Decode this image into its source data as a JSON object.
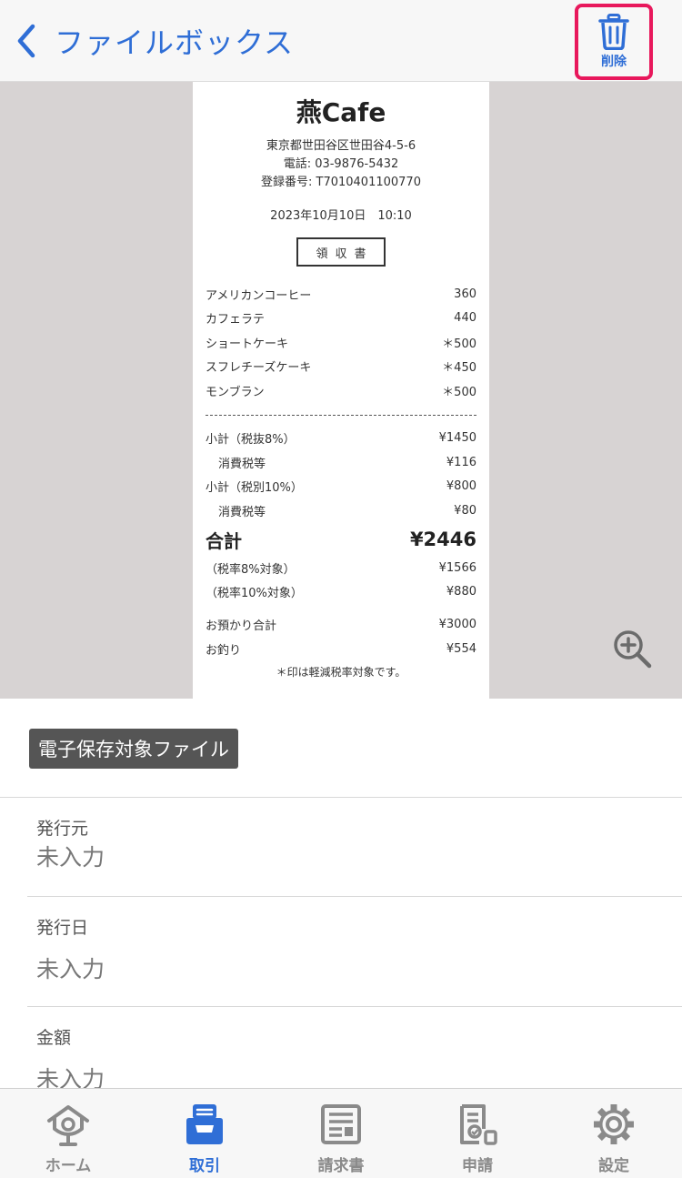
{
  "header": {
    "back_label": "ファイルボックス",
    "delete_label": "削除"
  },
  "receipt": {
    "shop_name": "燕Cafe",
    "address": "東京都世田谷区世田谷4-5-6",
    "phone": "電話: 03-9876-5432",
    "registration": "登録番号: T7010401100770",
    "datetime": "2023年10月10日　10:10",
    "doc_title": "領収書",
    "items": [
      {
        "name": "アメリカンコーヒー",
        "price": "360"
      },
      {
        "name": "カフェラテ",
        "price": "440"
      },
      {
        "name": "ショートケーキ",
        "price": "＊500"
      },
      {
        "name": "スフレチーズケーキ",
        "price": "＊450"
      },
      {
        "name": "モンブラン",
        "price": "＊500"
      }
    ],
    "subtotals": [
      {
        "name": "小計（税抜8%）",
        "value": "¥1450"
      },
      {
        "name": "消費税等",
        "value": "¥116"
      },
      {
        "name": "小計（税別10%）",
        "value": "¥800"
      },
      {
        "name": "消費税等",
        "value": "¥80"
      }
    ],
    "total": {
      "name": "合計",
      "value": "¥2446"
    },
    "tax_breakdown": [
      {
        "name": "（税率8%対象）",
        "value": "¥1566"
      },
      {
        "name": "（税率10%対象）",
        "value": "¥880"
      }
    ],
    "payment": [
      {
        "name": "お預かり合計",
        "value": "¥3000"
      },
      {
        "name": "お釣り",
        "value": "¥554"
      }
    ],
    "note": "＊印は軽減税率対象です。"
  },
  "details": {
    "badge": "電子保存対象ファイル",
    "fields": [
      {
        "label": "発行元",
        "value": "未入力"
      },
      {
        "label": "発行日",
        "value": "未入力"
      },
      {
        "label": "金額",
        "value": "未入力"
      }
    ]
  },
  "tabs": [
    {
      "label": "ホーム",
      "icon": "home-icon"
    },
    {
      "label": "取引",
      "icon": "inbox-icon"
    },
    {
      "label": "請求書",
      "icon": "invoice-icon"
    },
    {
      "label": "申請",
      "icon": "application-icon"
    },
    {
      "label": "設定",
      "icon": "gear-icon"
    }
  ],
  "colors": {
    "accent": "#2f6ed6",
    "highlight": "#e8185c",
    "preview_bg": "#d7d3d3",
    "badge_bg": "#555555"
  }
}
